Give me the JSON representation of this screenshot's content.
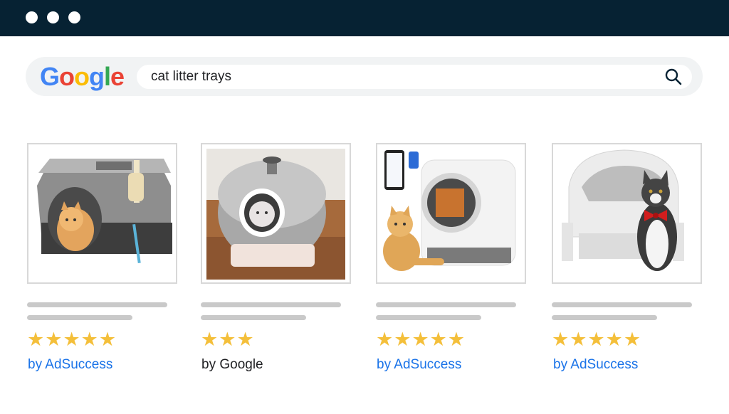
{
  "window": {
    "controls": [
      "dot",
      "dot",
      "dot"
    ]
  },
  "search": {
    "logo_letters": [
      {
        "ch": "G",
        "color": "#4285F4"
      },
      {
        "ch": "o",
        "color": "#EA4335"
      },
      {
        "ch": "o",
        "color": "#FBBC05"
      },
      {
        "ch": "g",
        "color": "#4285F4"
      },
      {
        "ch": "l",
        "color": "#34A853"
      },
      {
        "ch": "e",
        "color": "#EA4335"
      }
    ],
    "query": "cat litter trays",
    "icon": "search-icon"
  },
  "colors": {
    "titlebar": "#062233",
    "link": "#1a73e8",
    "star": "#f4bf3a"
  },
  "products": [
    {
      "image": "grey hooded litter box with orange cat",
      "rating": 5,
      "seller": "by AdSuccess"
    },
    {
      "image": "grey dome litter box with white cat inside",
      "rating": 3,
      "seller": "by Google"
    },
    {
      "image": "white self-cleaning litter box with phone app and cat",
      "rating": 5,
      "seller": "by AdSuccess"
    },
    {
      "image": "white open litter box with cat wearing red bow",
      "rating": 5,
      "seller": "by AdSuccess"
    }
  ]
}
